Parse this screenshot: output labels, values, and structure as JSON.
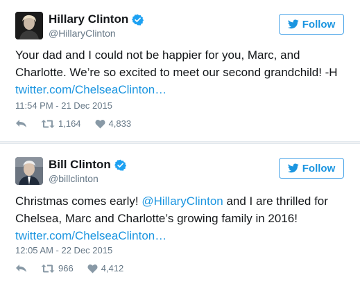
{
  "tweets": [
    {
      "display_name": "Hillary Clinton",
      "handle": "@HillaryClinton",
      "follow_label": "Follow",
      "text_line1": "Your dad and I could not be happier for you, Marc, and",
      "text_line2": "Charlotte. We’re so excited to meet our second grandchild! -H",
      "link": "twitter.com/ChelseaClinton…",
      "timestamp": "11:54 PM - 21 Dec 2015",
      "retweets": "1,164",
      "likes": "4,833"
    },
    {
      "display_name": "Bill Clinton",
      "handle": "@billclinton",
      "follow_label": "Follow",
      "text_line1_a": "Christmas comes early! ",
      "mention": "@HillaryClinton",
      "text_line1_b": " and I are thrilled for",
      "text_line2": "Chelsea, Marc and Charlotte’s growing family in 2016!",
      "link": "twitter.com/ChelseaClinton…",
      "timestamp": "12:05 AM - 22 Dec 2015",
      "retweets": "966",
      "likes": "4,412"
    }
  ],
  "colors": {
    "accent": "#1b95e0",
    "verified": "#1da1f2",
    "muted": "#657786",
    "text": "#14171a"
  },
  "icons": [
    "verified-badge-icon",
    "twitter-bird-icon",
    "reply-icon",
    "retweet-icon",
    "like-heart-icon"
  ]
}
